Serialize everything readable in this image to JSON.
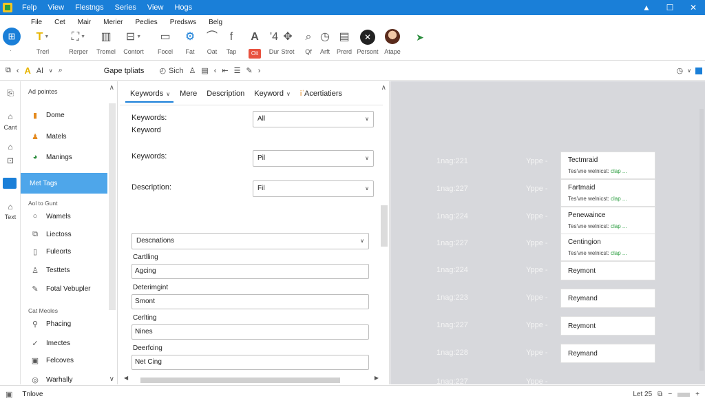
{
  "titlebar": {
    "menu": [
      "Felp",
      "View",
      "Flestngs",
      "Series",
      "View",
      "Hogs"
    ],
    "controls": [
      "▲",
      "☐",
      "✕"
    ]
  },
  "ribbon": {
    "tabs": [
      "File",
      "Cet",
      "Mair",
      "Merier",
      "Peclies",
      "Predsws",
      "Belg"
    ],
    "tools": [
      {
        "label": "Trerl",
        "icon": "pen-icon"
      },
      {
        "label": "Rerper",
        "icon": "paint-icon"
      },
      {
        "label": "Tromel",
        "icon": "panel-icon"
      },
      {
        "label": "Contort",
        "icon": "layout-icon"
      },
      {
        "label": "Focel",
        "icon": "document-icon"
      },
      {
        "label": "Fat",
        "icon": "share-icon"
      },
      {
        "label": "Oat",
        "icon": "curve-icon"
      },
      {
        "label": "Tap",
        "icon": "function-icon"
      },
      {
        "label": "Oit",
        "icon": "font-icon"
      },
      {
        "label": "Dur",
        "icon": "number-icon"
      },
      {
        "label": "Strot",
        "icon": "settings-icon"
      },
      {
        "label": "Qf",
        "icon": "search-icon"
      },
      {
        "label": "Arft",
        "icon": "clock-icon"
      },
      {
        "label": "Prerd",
        "icon": "page-icon"
      },
      {
        "label": "Persont",
        "icon": "close-circle-icon"
      },
      {
        "label": "Atape",
        "icon": "avatar-icon"
      }
    ]
  },
  "toolbar": {
    "pages_label": "Gape tpliats",
    "sich_label": "Sich",
    "font_label": "Al"
  },
  "rail": {
    "cant": "Cant",
    "text": "Text"
  },
  "nav": {
    "header": "Ad pointes",
    "items": [
      {
        "label": "Dome"
      },
      {
        "label": "Matels"
      },
      {
        "label": "Manings"
      },
      {
        "label": "Met Tags"
      }
    ],
    "section1": "Aol to Gunt",
    "items2": [
      {
        "label": "Wamels"
      },
      {
        "label": "Liectoss"
      },
      {
        "label": "Fuleorts"
      },
      {
        "label": "Testtets"
      },
      {
        "label": "Fotal Vebupler"
      }
    ],
    "section2": "Cat Meoles",
    "items3": [
      {
        "label": "Phacing"
      },
      {
        "label": "Imectes"
      },
      {
        "label": "Felcoves"
      },
      {
        "label": "Warhally"
      }
    ]
  },
  "form": {
    "tabs": [
      "Keywords",
      "Mere",
      "Description",
      "Keyword",
      "Acertiatiers"
    ],
    "keywords_label": "Keywords:",
    "keyword_label": "Keyword",
    "keywords_select": "All",
    "keywords2_label": "Keywords:",
    "keywords2_select": "Pil",
    "description_label": "Description:",
    "description_select": "Fil",
    "descnations_select": "Descnations",
    "cartlling_label": "Cartlling",
    "cartlling_value": "Agcing",
    "deterimgint_label": "Deterimgint",
    "deterimgint_value": "Smont",
    "cerlting_label": "Cerlting",
    "cerlting_value": "Nines",
    "deerfcing_label": "Deerfcing",
    "deerfcing_value": "Net Cing"
  },
  "preview": {
    "rows": [
      {
        "left": "1nag:221",
        "mid": "Yppe -",
        "title": "Tectmraid",
        "sub": "Tes'vne welnicst:",
        "sub_green": "clap ..."
      },
      {
        "left": "1nag:227",
        "mid": "Yppe -",
        "title": "Fartmaid",
        "sub": "Tes'vne welnicst:",
        "sub_green": "clap ..."
      },
      {
        "left": "1nag:224",
        "mid": "Yppe -",
        "title": "Penewaince",
        "sub": "Tes'vne welnicst:",
        "sub_green": "clap ..."
      },
      {
        "left": "1nag:227",
        "mid": "Yppe -",
        "title": "Centingion",
        "sub": "Tes'vne welnicst:",
        "sub_green": "clap ..."
      },
      {
        "left": "1nag:224",
        "mid": "Yppe -",
        "title": "Reymont",
        "sub": "",
        "sub_green": ""
      },
      {
        "left": "1nag:223",
        "mid": "Yppe -",
        "title": "Reymand",
        "sub": "",
        "sub_green": ""
      },
      {
        "left": "1nag:227",
        "mid": "Yppe -",
        "title": "Reymont",
        "sub": "",
        "sub_green": ""
      },
      {
        "left": "1nag:228",
        "mid": "Yppe -",
        "title": "Reymand",
        "sub": "",
        "sub_green": ""
      },
      {
        "left": "1nag:227",
        "mid": "Yppe -",
        "title": "",
        "sub": "",
        "sub_green": ""
      }
    ]
  },
  "status": {
    "text": "Tnlove",
    "zoom": "Let 25"
  },
  "colors": {
    "accent": "#1a7fd8",
    "nav_active": "#4ea6ea",
    "preview_bg": "#d7d8dc",
    "green": "#2a9d3f"
  }
}
